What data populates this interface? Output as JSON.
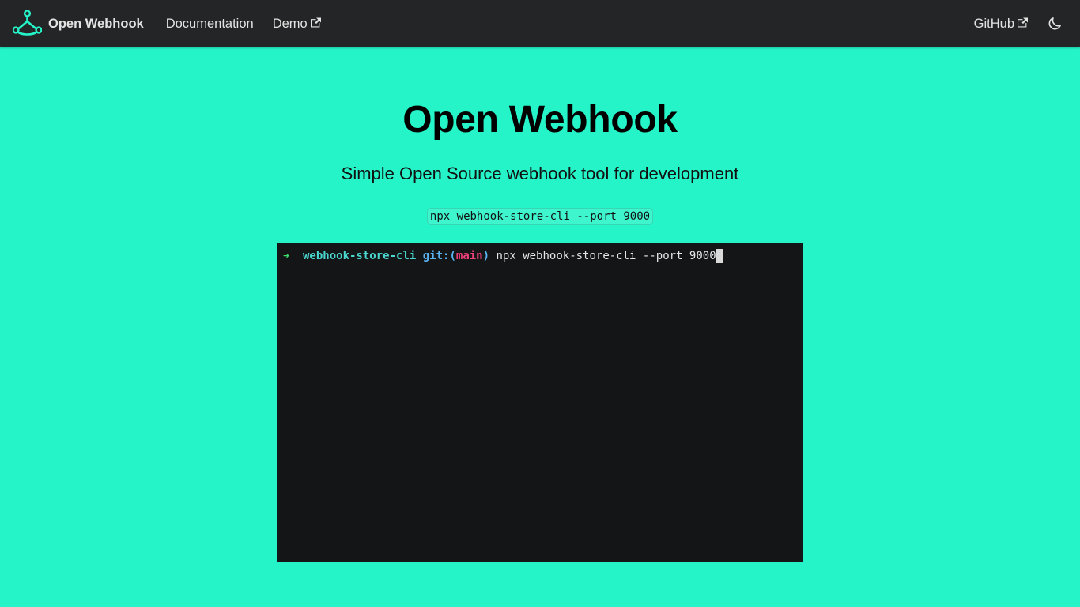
{
  "navbar": {
    "brand_title": "Open Webhook",
    "links": {
      "documentation": "Documentation",
      "demo": "Demo",
      "github": "GitHub"
    },
    "icons": {
      "logo": "open-webhook-logo",
      "external_link": "external-link-icon",
      "theme": "moon-icon"
    }
  },
  "hero": {
    "title": "Open Webhook",
    "subtitle": "Simple Open Source webhook tool for development",
    "command": "npx webhook-store-cli --port 9000"
  },
  "terminal": {
    "prompt_arrow": "➜",
    "directory": "webhook-store-cli",
    "git_prefix": "git:(",
    "branch": "main",
    "git_suffix": ")",
    "command": "npx webhook-store-cli --port 9000"
  },
  "colors": {
    "page_background": "#25f4c8",
    "navbar_background": "#242526",
    "terminal_background": "#141517",
    "brand_accent": "#25f4c8"
  }
}
